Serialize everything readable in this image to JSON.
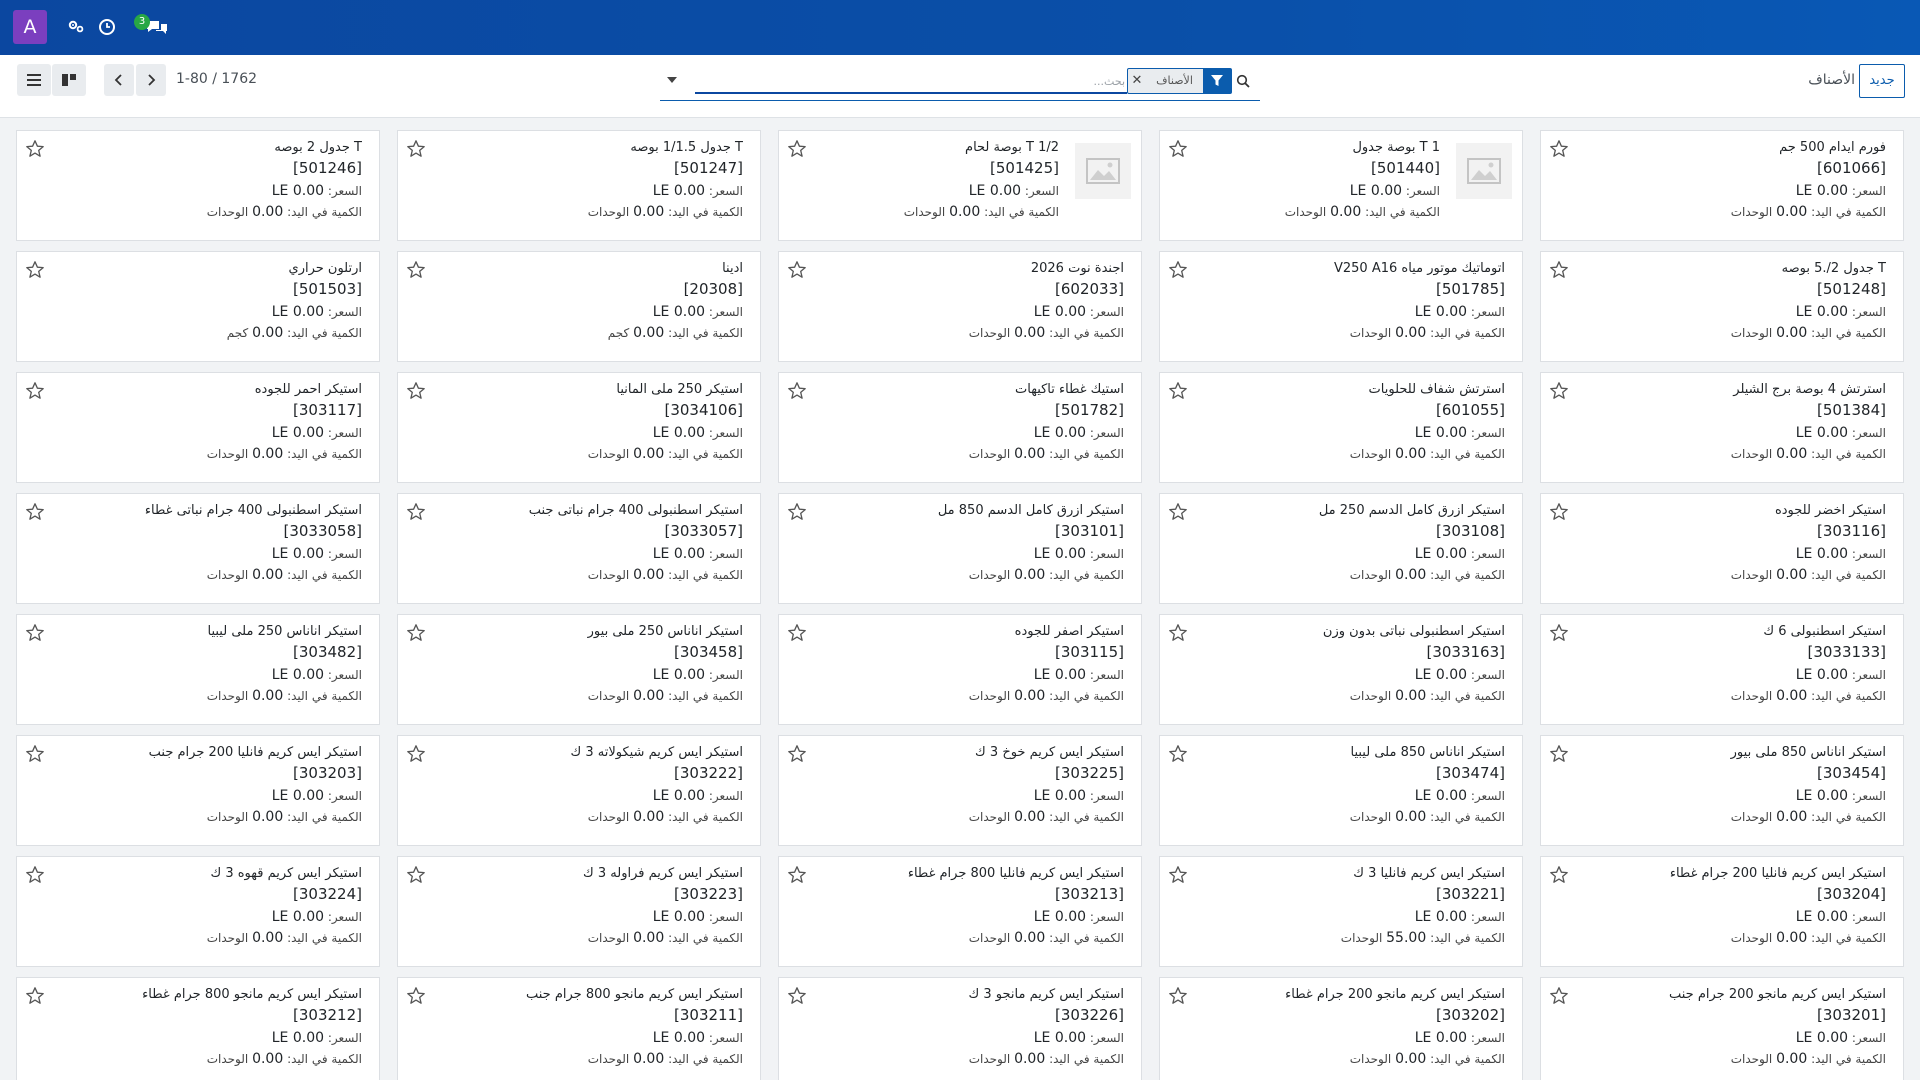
{
  "navbar": {
    "avatar_letter": "A",
    "badge_count": "3",
    "icons": [
      "cogs-icon",
      "clock-icon",
      "chat-icon"
    ]
  },
  "control": {
    "new_button": "جديد",
    "title": "الأصناف",
    "pager": "1-80 / 1762",
    "search_placeholder": "بحث...",
    "facet_value": "الأصناف"
  },
  "labels": {
    "price_prefix": "السعر:",
    "qty_prefix": "الكمية في اليد:"
  },
  "colors": {
    "navbar": "#0b47a0",
    "avatar": "#7b3fbf",
    "accent": "#0b5cad",
    "badge": "#28a745"
  },
  "products": [
    {
      "name": "فورم ايدام 500 جم",
      "code": "[601066]",
      "price": "0.00 LE",
      "qty": "0.00",
      "unit": "الوحدات",
      "img": false
    },
    {
      "name": "T 1 بوصة جدول",
      "code": "[501440]",
      "price": "0.00 LE",
      "qty": "0.00",
      "unit": "الوحدات",
      "img": true
    },
    {
      "name": "T 1/2 بوصة لحام",
      "code": "[501425]",
      "price": "0.00 LE",
      "qty": "0.00",
      "unit": "الوحدات",
      "img": true
    },
    {
      "name": "T جدول 1/1.5 بوصه",
      "code": "[501247]",
      "price": "0.00 LE",
      "qty": "0.00",
      "unit": "الوحدات",
      "img": false
    },
    {
      "name": "T جدول 2 بوصه",
      "code": "[501246]",
      "price": "0.00 LE",
      "qty": "0.00",
      "unit": "الوحدات",
      "img": false
    },
    {
      "name": "T جدول 2/.5 بوصه",
      "code": "[501248]",
      "price": "0.00 LE",
      "qty": "0.00",
      "unit": "الوحدات",
      "img": false
    },
    {
      "name": "اتوماتيك موتور مياه V250 A16",
      "code": "[501785]",
      "price": "0.00 LE",
      "qty": "0.00",
      "unit": "الوحدات",
      "img": false
    },
    {
      "name": "اجندة نوت 2026",
      "code": "[602033]",
      "price": "0.00 LE",
      "qty": "0.00",
      "unit": "الوحدات",
      "img": false
    },
    {
      "name": "ادينا",
      "code": "[20308]",
      "price": "0.00 LE",
      "qty": "0.00",
      "unit": "كجم",
      "img": false
    },
    {
      "name": "ارتلون حراري",
      "code": "[501503]",
      "price": "0.00 LE",
      "qty": "0.00",
      "unit": "كجم",
      "img": false
    },
    {
      "name": "استرتش 4 بوصة برج الشيلر",
      "code": "[501384]",
      "price": "0.00 LE",
      "qty": "0.00",
      "unit": "الوحدات",
      "img": false
    },
    {
      "name": "استرتش شفاف للحلويات",
      "code": "[601055]",
      "price": "0.00 LE",
      "qty": "0.00",
      "unit": "الوحدات",
      "img": false
    },
    {
      "name": "استيك غطاء تاكيهات",
      "code": "[501782]",
      "price": "0.00 LE",
      "qty": "0.00",
      "unit": "الوحدات",
      "img": false
    },
    {
      "name": "استيكر 250 ملى المانيا",
      "code": "[3034106]",
      "price": "0.00 LE",
      "qty": "0.00",
      "unit": "الوحدات",
      "img": false
    },
    {
      "name": "استيكر احمر للجوده",
      "code": "[303117]",
      "price": "0.00 LE",
      "qty": "0.00",
      "unit": "الوحدات",
      "img": false
    },
    {
      "name": "استيكر اخضر للجوده",
      "code": "[303116]",
      "price": "0.00 LE",
      "qty": "0.00",
      "unit": "الوحدات",
      "img": false
    },
    {
      "name": "استيكر ازرق كامل الدسم 250 مل",
      "code": "[303108]",
      "price": "0.00 LE",
      "qty": "0.00",
      "unit": "الوحدات",
      "img": false
    },
    {
      "name": "استيكر ازرق كامل الدسم 850 مل",
      "code": "[303101]",
      "price": "0.00 LE",
      "qty": "0.00",
      "unit": "الوحدات",
      "img": false
    },
    {
      "name": "استيكر اسطنبولى 400 جرام نباتى جنب",
      "code": "[3033057]",
      "price": "0.00 LE",
      "qty": "0.00",
      "unit": "الوحدات",
      "img": false
    },
    {
      "name": "استيكر اسطنبولى 400 جرام نباتى غطاء",
      "code": "[3033058]",
      "price": "0.00 LE",
      "qty": "0.00",
      "unit": "الوحدات",
      "img": false
    },
    {
      "name": "استيكر اسطنبولى 6 ك",
      "code": "[3033133]",
      "price": "0.00 LE",
      "qty": "0.00",
      "unit": "الوحدات",
      "img": false
    },
    {
      "name": "استيكر اسطنبولى نباتى بدون وزن",
      "code": "[3033163]",
      "price": "0.00 LE",
      "qty": "0.00",
      "unit": "الوحدات",
      "img": false
    },
    {
      "name": "استيكر اصفر للجوده",
      "code": "[303115]",
      "price": "0.00 LE",
      "qty": "0.00",
      "unit": "الوحدات",
      "img": false
    },
    {
      "name": "استيكر اناناس 250 ملى بيور",
      "code": "[303458]",
      "price": "0.00 LE",
      "qty": "0.00",
      "unit": "الوحدات",
      "img": false
    },
    {
      "name": "استيكر اناناس 250 ملى ليبيا",
      "code": "[303482]",
      "price": "0.00 LE",
      "qty": "0.00",
      "unit": "الوحدات",
      "img": false
    },
    {
      "name": "استيكر اناناس 850 ملى بيور",
      "code": "[303454]",
      "price": "0.00 LE",
      "qty": "0.00",
      "unit": "الوحدات",
      "img": false
    },
    {
      "name": "استيكر اناناس 850 ملى ليبيا",
      "code": "[303474]",
      "price": "0.00 LE",
      "qty": "0.00",
      "unit": "الوحدات",
      "img": false
    },
    {
      "name": "استيكر ايس كريم خوخ 3 ك",
      "code": "[303225]",
      "price": "0.00 LE",
      "qty": "0.00",
      "unit": "الوحدات",
      "img": false
    },
    {
      "name": "استيكر ايس كريم شيكولاته 3 ك",
      "code": "[303222]",
      "price": "0.00 LE",
      "qty": "0.00",
      "unit": "الوحدات",
      "img": false
    },
    {
      "name": "استيكر ايس كريم فانليا 200 جرام جنب",
      "code": "[303203]",
      "price": "0.00 LE",
      "qty": "0.00",
      "unit": "الوحدات",
      "img": false
    },
    {
      "name": "استيكر ايس كريم فانليا 200 جرام غطاء",
      "code": "[303204]",
      "price": "0.00 LE",
      "qty": "0.00",
      "unit": "الوحدات",
      "img": false
    },
    {
      "name": "استيكر ايس كريم فانليا 3 ك",
      "code": "[303221]",
      "price": "0.00 LE",
      "qty": "55.00",
      "unit": "الوحدات",
      "img": false
    },
    {
      "name": "استيكر ايس كريم فانليا 800 جرام غطاء",
      "code": "[303213]",
      "price": "0.00 LE",
      "qty": "0.00",
      "unit": "الوحدات",
      "img": false
    },
    {
      "name": "استيكر ايس كريم فراوله 3 ك",
      "code": "[303223]",
      "price": "0.00 LE",
      "qty": "0.00",
      "unit": "الوحدات",
      "img": false
    },
    {
      "name": "استيكر ايس كريم قهوه 3 ك",
      "code": "[303224]",
      "price": "0.00 LE",
      "qty": "0.00",
      "unit": "الوحدات",
      "img": false
    },
    {
      "name": "استيكر ايس كريم مانجو 200 جرام جنب",
      "code": "[303201]",
      "price": "0.00 LE",
      "qty": "0.00",
      "unit": "الوحدات",
      "img": false
    },
    {
      "name": "استيكر ايس كريم مانجو 200 جرام غطاء",
      "code": "[303202]",
      "price": "0.00 LE",
      "qty": "0.00",
      "unit": "الوحدات",
      "img": false
    },
    {
      "name": "استيكر ايس كريم مانجو 3 ك",
      "code": "[303226]",
      "price": "0.00 LE",
      "qty": "0.00",
      "unit": "الوحدات",
      "img": false
    },
    {
      "name": "استيكر ايس كريم مانجو 800 جرام جنب",
      "code": "[303211]",
      "price": "0.00 LE",
      "qty": "0.00",
      "unit": "الوحدات",
      "img": false
    },
    {
      "name": "استيكر ايس كريم مانجو 800 جرام غطاء",
      "code": "[303212]",
      "price": "0.00 LE",
      "qty": "0.00",
      "unit": "الوحدات",
      "img": false
    }
  ]
}
